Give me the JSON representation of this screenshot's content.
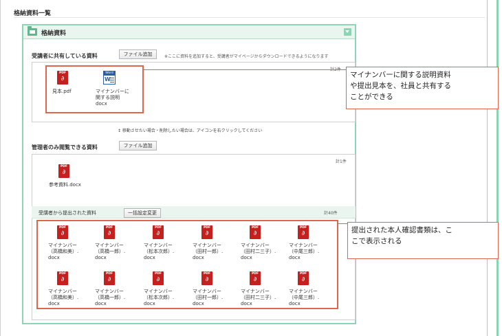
{
  "page": {
    "title": "格納資料一覧"
  },
  "panel": {
    "title": "格納資料"
  },
  "shared_section": {
    "label": "受講者に共有している資料",
    "add_button": "ファイル追加",
    "note": "※ここに資料を追加すると、受講者がマイページからダウンロードできるようになります",
    "count": "計2件",
    "files": [
      {
        "type": "pdf",
        "lines": [
          "見本.pdf"
        ]
      },
      {
        "type": "word",
        "lines": [
          "マイナンバーに",
          "関する説明",
          "docx"
        ]
      }
    ]
  },
  "move_hint": "↕ 移動させたい場合・削除したい場合は、アイコンを右クリックしてください",
  "admin_section": {
    "label": "管理者のみ閲覧できる資料",
    "add_button": "ファイル追加",
    "count": "計1件",
    "files": [
      {
        "type": "pdf",
        "lines": [
          "参考資料.docx"
        ]
      }
    ]
  },
  "submitted_section": {
    "label": "受講者から提出された資料",
    "bulk_button": "一括設定変更",
    "count": "計40件",
    "rows": [
      [
        {
          "type": "pdf",
          "lines": [
            "マイナンバー",
            "（高橋和美）.",
            "docx"
          ]
        },
        {
          "type": "pdf",
          "lines": [
            "マイナンバー",
            "（高橋一郎）.",
            "docx"
          ]
        },
        {
          "type": "pdf",
          "lines": [
            "マイナンバー",
            "（松本次郎）.",
            "docx"
          ]
        },
        {
          "type": "pdf",
          "lines": [
            "マイナンバー",
            "（田村一郎）.",
            "docx"
          ]
        },
        {
          "type": "pdf",
          "lines": [
            "マイナンバー",
            "（田村二三子）.",
            "docx"
          ]
        },
        {
          "type": "pdf",
          "lines": [
            "マイナンバー",
            "（中尾三郎）.",
            "docx"
          ]
        }
      ],
      [
        {
          "type": "pdf",
          "lines": [
            "マイナンバー",
            "（高橋和美）.",
            "docx"
          ]
        },
        {
          "type": "pdf",
          "lines": [
            "マイナンバー",
            "（高橋一郎）.",
            "docx"
          ]
        },
        {
          "type": "pdf",
          "lines": [
            "マイナンバー",
            "（松本次郎）.",
            "docx"
          ]
        },
        {
          "type": "pdf",
          "lines": [
            "マイナンバー",
            "（田村一郎）.",
            "docx"
          ]
        },
        {
          "type": "pdf",
          "lines": [
            "マイナンバー",
            "（田村二三子）.",
            "docx"
          ]
        },
        {
          "type": "pdf",
          "lines": [
            "マイナンバー",
            "（中尾三郎）.",
            "docx"
          ]
        }
      ]
    ]
  },
  "callouts": [
    {
      "text_lines": [
        "マイナンバーに関する説明資料",
        "や提出見本を、社員と共有する",
        "ことができる"
      ]
    },
    {
      "text_lines": [
        "提出された本人確認書類は、こ",
        "こで表示される"
      ]
    }
  ],
  "colors": {
    "accent_green": "#8fd3b5",
    "callout_orange": "#e0664b",
    "pdf_red": "#c5201e",
    "word_blue": "#2a5caa"
  }
}
